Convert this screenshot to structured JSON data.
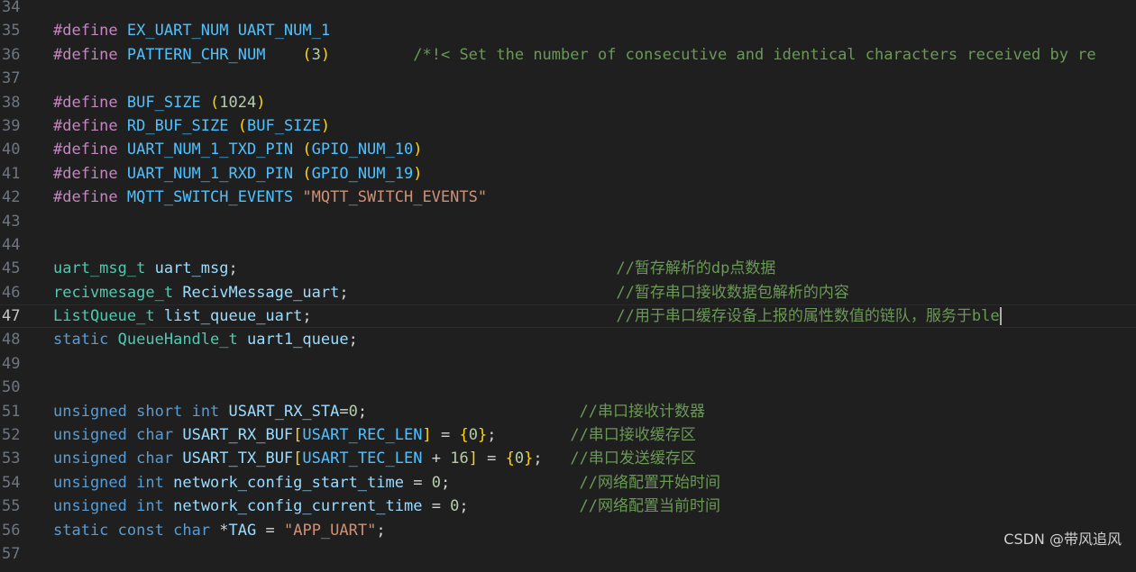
{
  "editor": {
    "theme": {
      "background": "#1f1f1f",
      "line_number_color": "#6e7681",
      "preprocessor_color": "#c586c0",
      "keyword_color": "#569cd6",
      "type_color": "#4ec9b0",
      "variable_color": "#9cdcfe",
      "number_color": "#b5cea8",
      "string_color": "#ce9178",
      "comment_color": "#6a9955",
      "bracket_gold": "#ffd700",
      "bracket_violet": "#da70d6"
    },
    "current_line": 47,
    "lines": [
      {
        "n": "34"
      },
      {
        "n": "35",
        "tokens": [
          [
            "pp",
            "#define"
          ],
          [
            "plain",
            " "
          ],
          [
            "mac",
            "EX_UART_NUM"
          ],
          [
            "plain",
            " "
          ],
          [
            "mac",
            "UART_NUM_1"
          ]
        ]
      },
      {
        "n": "36",
        "tokens": [
          [
            "pp",
            "#define"
          ],
          [
            "plain",
            " "
          ],
          [
            "mac",
            "PATTERN_CHR_NUM"
          ],
          [
            "plain",
            "    "
          ],
          [
            "b1",
            "("
          ],
          [
            "num",
            "3"
          ],
          [
            "b1",
            ")"
          ],
          [
            "plain",
            "         "
          ],
          [
            "cmt",
            "/*!< Set the number of consecutive and identical characters received by re"
          ]
        ]
      },
      {
        "n": "37"
      },
      {
        "n": "38",
        "tokens": [
          [
            "pp",
            "#define"
          ],
          [
            "plain",
            " "
          ],
          [
            "mac",
            "BUF_SIZE"
          ],
          [
            "plain",
            " "
          ],
          [
            "b1",
            "("
          ],
          [
            "num",
            "1024"
          ],
          [
            "b1",
            ")"
          ]
        ]
      },
      {
        "n": "39",
        "tokens": [
          [
            "pp",
            "#define"
          ],
          [
            "plain",
            " "
          ],
          [
            "mac",
            "RD_BUF_SIZE"
          ],
          [
            "plain",
            " "
          ],
          [
            "b1",
            "("
          ],
          [
            "mac",
            "BUF_SIZE"
          ],
          [
            "b1",
            ")"
          ]
        ]
      },
      {
        "n": "40",
        "tokens": [
          [
            "pp",
            "#define"
          ],
          [
            "plain",
            " "
          ],
          [
            "mac",
            "UART_NUM_1_TXD_PIN"
          ],
          [
            "plain",
            " "
          ],
          [
            "b1",
            "("
          ],
          [
            "mac",
            "GPIO_NUM_10"
          ],
          [
            "b1",
            ")"
          ]
        ]
      },
      {
        "n": "41",
        "tokens": [
          [
            "pp",
            "#define"
          ],
          [
            "plain",
            " "
          ],
          [
            "mac",
            "UART_NUM_1_RXD_PIN"
          ],
          [
            "plain",
            " "
          ],
          [
            "b1",
            "("
          ],
          [
            "mac",
            "GPIO_NUM_19"
          ],
          [
            "b1",
            ")"
          ]
        ]
      },
      {
        "n": "42",
        "tokens": [
          [
            "pp",
            "#define"
          ],
          [
            "plain",
            " "
          ],
          [
            "mac",
            "MQTT_SWITCH_EVENTS"
          ],
          [
            "plain",
            " "
          ],
          [
            "str",
            "\"MQTT_SWITCH_EVENTS\""
          ]
        ]
      },
      {
        "n": "43"
      },
      {
        "n": "44"
      },
      {
        "n": "45",
        "tokens": [
          [
            "ty",
            "uart_msg_t"
          ],
          [
            "plain",
            " "
          ],
          [
            "var",
            "uart_msg"
          ],
          [
            "plain",
            ";                                         "
          ],
          [
            "cmt",
            "//暂存解析的dp点数据"
          ]
        ]
      },
      {
        "n": "46",
        "tokens": [
          [
            "ty",
            "recivmesage_t"
          ],
          [
            "plain",
            " "
          ],
          [
            "var",
            "RecivMessage_uart"
          ],
          [
            "plain",
            ";                             "
          ],
          [
            "cmt",
            "//暂存串口接收数据包解析的内容"
          ]
        ]
      },
      {
        "n": "47",
        "tokens": [
          [
            "ty",
            "ListQueue_t"
          ],
          [
            "plain",
            " "
          ],
          [
            "var",
            "list_queue_uart"
          ],
          [
            "plain",
            ";                                 "
          ],
          [
            "cmt",
            "//用于串口缓存设备上报的属性数值的链队，服务于ble"
          ]
        ],
        "cursor": true
      },
      {
        "n": "48",
        "tokens": [
          [
            "kw",
            "static"
          ],
          [
            "plain",
            " "
          ],
          [
            "ty",
            "QueueHandle_t"
          ],
          [
            "plain",
            " "
          ],
          [
            "var",
            "uart1_queue"
          ],
          [
            "plain",
            ";"
          ]
        ]
      },
      {
        "n": "49"
      },
      {
        "n": "50"
      },
      {
        "n": "51",
        "tokens": [
          [
            "kw",
            "unsigned"
          ],
          [
            "plain",
            " "
          ],
          [
            "kw",
            "short"
          ],
          [
            "plain",
            " "
          ],
          [
            "kw",
            "int"
          ],
          [
            "plain",
            " "
          ],
          [
            "var",
            "USART_RX_STA"
          ],
          [
            "plain",
            "="
          ],
          [
            "num",
            "0"
          ],
          [
            "plain",
            ";                       "
          ],
          [
            "cmt",
            "//串口接收计数器"
          ]
        ]
      },
      {
        "n": "52",
        "tokens": [
          [
            "kw",
            "unsigned"
          ],
          [
            "plain",
            " "
          ],
          [
            "kw",
            "char"
          ],
          [
            "plain",
            " "
          ],
          [
            "var",
            "USART_RX_BUF"
          ],
          [
            "b1",
            "["
          ],
          [
            "mac",
            "USART_REC_LEN"
          ],
          [
            "b1",
            "]"
          ],
          [
            "plain",
            " = "
          ],
          [
            "b1",
            "{"
          ],
          [
            "num",
            "0"
          ],
          [
            "b1",
            "}"
          ],
          [
            "plain",
            ";        "
          ],
          [
            "cmt",
            "//串口接收缓存区"
          ]
        ]
      },
      {
        "n": "53",
        "tokens": [
          [
            "kw",
            "unsigned"
          ],
          [
            "plain",
            " "
          ],
          [
            "kw",
            "char"
          ],
          [
            "plain",
            " "
          ],
          [
            "var",
            "USART_TX_BUF"
          ],
          [
            "b1",
            "["
          ],
          [
            "mac",
            "USART_TEC_LEN"
          ],
          [
            "plain",
            " + "
          ],
          [
            "num",
            "16"
          ],
          [
            "b1",
            "]"
          ],
          [
            "plain",
            " = "
          ],
          [
            "b1",
            "{"
          ],
          [
            "num",
            "0"
          ],
          [
            "b1",
            "}"
          ],
          [
            "plain",
            ";   "
          ],
          [
            "cmt",
            "//串口发送缓存区"
          ]
        ]
      },
      {
        "n": "54",
        "tokens": [
          [
            "kw",
            "unsigned"
          ],
          [
            "plain",
            " "
          ],
          [
            "kw",
            "int"
          ],
          [
            "plain",
            " "
          ],
          [
            "var",
            "network_config_start_time"
          ],
          [
            "plain",
            " = "
          ],
          [
            "num",
            "0"
          ],
          [
            "plain",
            ";              "
          ],
          [
            "cmt",
            "//网络配置开始时间"
          ]
        ]
      },
      {
        "n": "55",
        "tokens": [
          [
            "kw",
            "unsigned"
          ],
          [
            "plain",
            " "
          ],
          [
            "kw",
            "int"
          ],
          [
            "plain",
            " "
          ],
          [
            "var",
            "network_config_current_time"
          ],
          [
            "plain",
            " = "
          ],
          [
            "num",
            "0"
          ],
          [
            "plain",
            ";            "
          ],
          [
            "cmt",
            "//网络配置当前时间"
          ]
        ]
      },
      {
        "n": "56",
        "tokens": [
          [
            "kw",
            "static"
          ],
          [
            "plain",
            " "
          ],
          [
            "kw",
            "const"
          ],
          [
            "plain",
            " "
          ],
          [
            "kw",
            "char"
          ],
          [
            "plain",
            " *"
          ],
          [
            "var",
            "TAG"
          ],
          [
            "plain",
            " = "
          ],
          [
            "str",
            "\"APP_UART\""
          ],
          [
            "plain",
            ";"
          ]
        ]
      },
      {
        "n": "57"
      }
    ]
  },
  "watermark": "CSDN @带风追风"
}
